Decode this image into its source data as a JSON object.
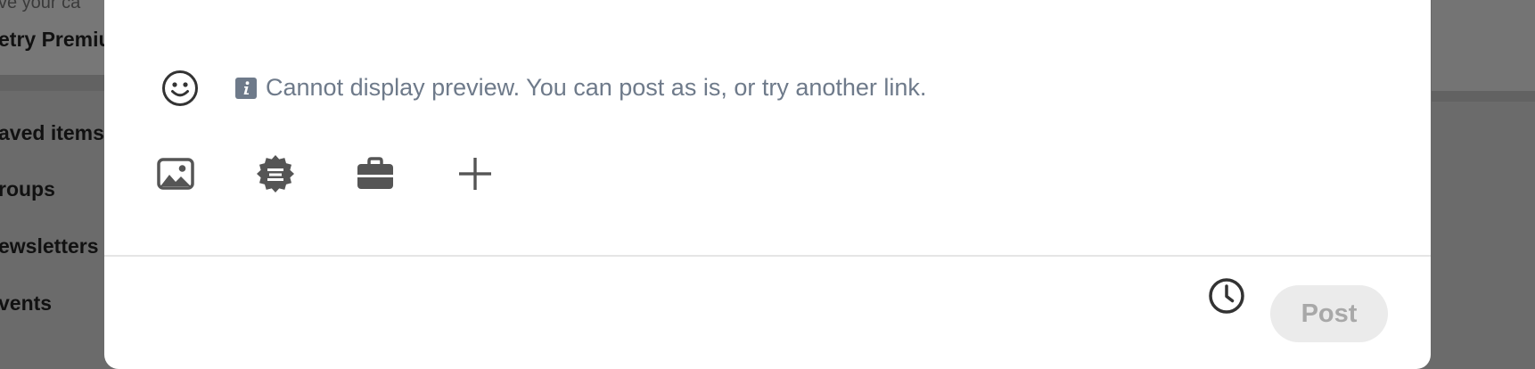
{
  "background": {
    "partial_line_1": "ve your ca",
    "partial_line_2": "etry Premiu",
    "sidebar_items": [
      "aved items",
      "roups",
      "ewsletters",
      "vents"
    ]
  },
  "composer": {
    "preview_message": "Cannot display preview. You can post as is, or try another link.",
    "post_label": "Post"
  },
  "icons": {
    "emoji": "smiley-icon",
    "info": "info-icon",
    "media": "image-icon",
    "badge": "celebrate-badge-icon",
    "job": "briefcase-icon",
    "more": "plus-icon",
    "schedule": "clock-icon"
  },
  "colors": {
    "overlay": "#6b6b6b",
    "modal_bg": "#ffffff",
    "icon": "#555555",
    "preview_text": "#6e7a8a",
    "post_bg_disabled": "#ebebeb",
    "post_text_disabled": "#a8a8a8"
  }
}
